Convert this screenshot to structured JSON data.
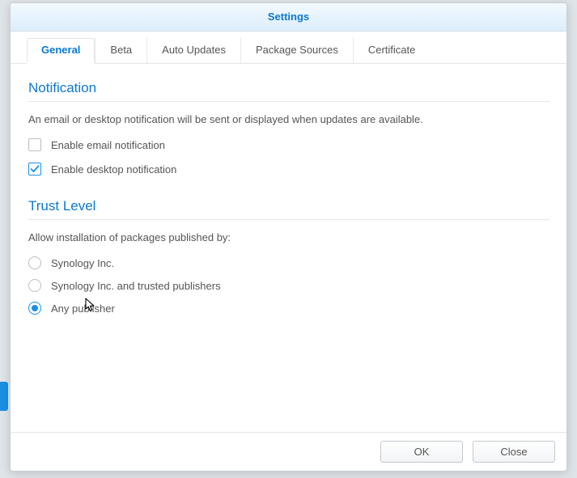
{
  "modal": {
    "title": "Settings",
    "tabs": [
      {
        "label": "General",
        "active": true
      },
      {
        "label": "Beta",
        "active": false
      },
      {
        "label": "Auto Updates",
        "active": false
      },
      {
        "label": "Package Sources",
        "active": false
      },
      {
        "label": "Certificate",
        "active": false
      }
    ]
  },
  "notification": {
    "heading": "Notification",
    "description": "An email or desktop notification will be sent or displayed when updates are available.",
    "email": {
      "label": "Enable email notification",
      "checked": false
    },
    "desktop": {
      "label": "Enable desktop notification",
      "checked": true
    }
  },
  "trust": {
    "heading": "Trust Level",
    "description": "Allow installation of packages published by:",
    "options": [
      {
        "label": "Synology Inc.",
        "selected": false
      },
      {
        "label": "Synology Inc. and trusted publishers",
        "selected": false
      },
      {
        "label": "Any publisher",
        "selected": true
      }
    ]
  },
  "buttons": {
    "ok": "OK",
    "close": "Close"
  }
}
